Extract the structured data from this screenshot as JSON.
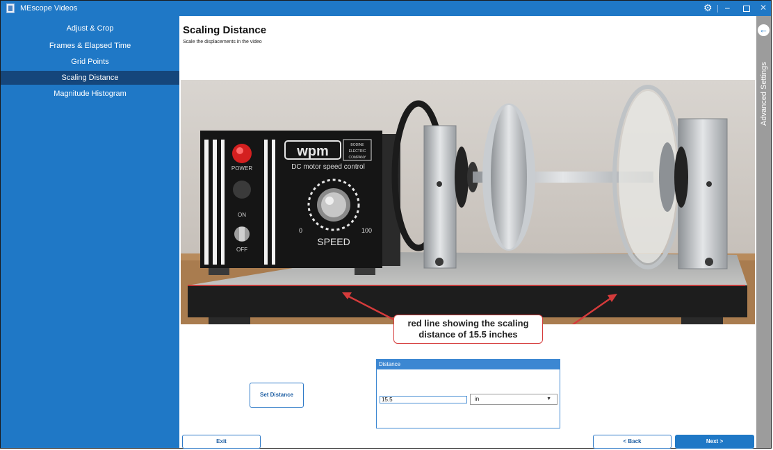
{
  "window": {
    "title": "MEscope Videos",
    "icons": {
      "app": "app-logo-icon",
      "settings": "gear-icon",
      "minimize": "minimize-icon",
      "maximize": "maximize-icon",
      "close": "close-icon"
    }
  },
  "sidebar": {
    "items": [
      {
        "label": "Adjust & Crop"
      },
      {
        "label": "Frames & Elapsed Time"
      },
      {
        "label": "Grid Points"
      },
      {
        "label": "Scaling Distance",
        "active": true
      },
      {
        "label": "Magnitude Histogram"
      }
    ],
    "colors": {
      "background": "#1f78c6",
      "active": "#15467b"
    }
  },
  "main": {
    "title": "Scaling Distance",
    "subtitle": "Scale the displacements in the video",
    "photo": {
      "control_box": {
        "brand": "wpm",
        "maker_lines": [
          "BODINE",
          "ELECTRIC",
          "COMPANY"
        ],
        "caption": "DC motor speed control",
        "labels": [
          "POWER",
          "ON",
          "OFF"
        ],
        "dial_min": "0",
        "dial_max": "100",
        "dial_label": "SPEED"
      }
    },
    "callout": {
      "line1": "red line showing the scaling",
      "line2": "distance of 15.5 inches"
    },
    "set_distance_label": "Set Distance",
    "distance_panel": {
      "header": "Distance",
      "value": "15.5",
      "unit": "in"
    },
    "buttons": {
      "exit": "Exit",
      "back": "< Back",
      "next": "Next >"
    }
  },
  "advanced": {
    "label": "Advanced Settings",
    "back_icon": "arrow-left-icon"
  },
  "colors": {
    "accent": "#1f78c6",
    "callout_border": "#d53b3b",
    "scale_line": "#e53030"
  }
}
